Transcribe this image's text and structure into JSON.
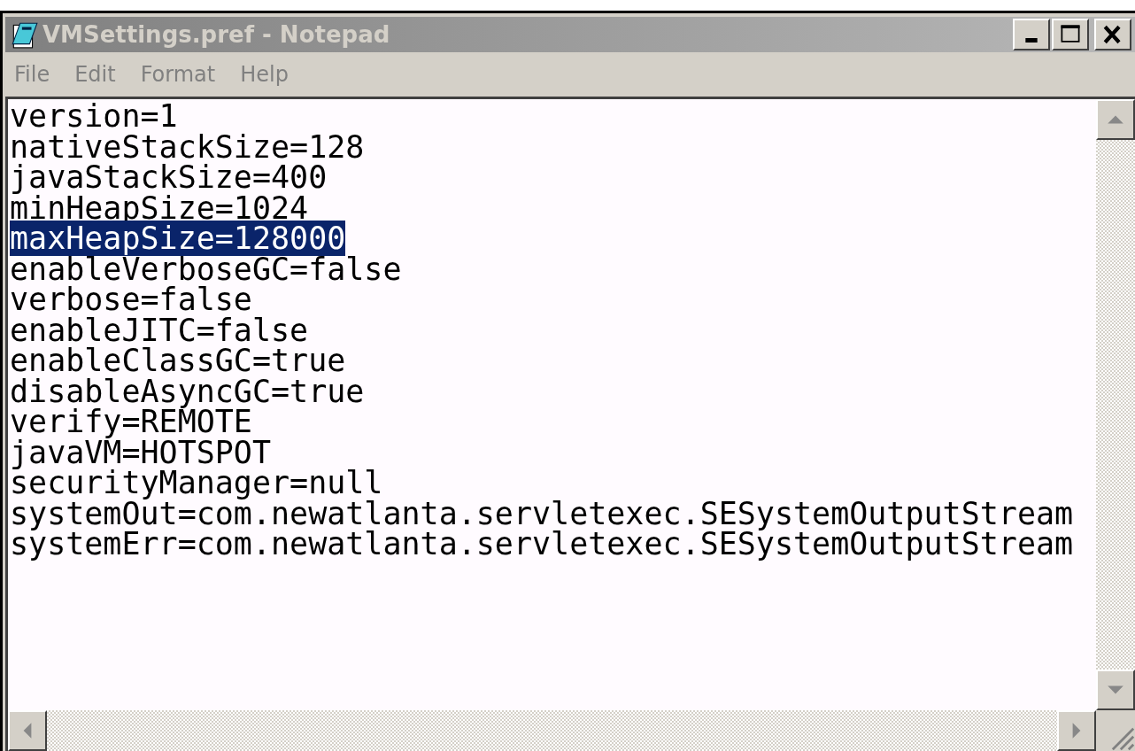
{
  "window": {
    "title": "VMSettings.pref - Notepad",
    "active": false
  },
  "menu": [
    {
      "label": "File"
    },
    {
      "label": "Edit"
    },
    {
      "label": "Format"
    },
    {
      "label": "Help"
    }
  ],
  "lines": [
    {
      "text": "version=1",
      "selected": false
    },
    {
      "text": "nativeStackSize=128",
      "selected": false
    },
    {
      "text": "javaStackSize=400",
      "selected": false
    },
    {
      "text": "minHeapSize=1024",
      "selected": false
    },
    {
      "text": "maxHeapSize=128000",
      "selected": true
    },
    {
      "text": "enableVerboseGC=false",
      "selected": false
    },
    {
      "text": "verbose=false",
      "selected": false
    },
    {
      "text": "enableJITC=false",
      "selected": false
    },
    {
      "text": "enableClassGC=true",
      "selected": false
    },
    {
      "text": "disableAsyncGC=true",
      "selected": false
    },
    {
      "text": "verify=REMOTE",
      "selected": false
    },
    {
      "text": "javaVM=HOTSPOT",
      "selected": false
    },
    {
      "text": "securityManager=null",
      "selected": false
    },
    {
      "text": "systemOut=com.newatlanta.servletexec.SESystemOutputStream",
      "selected": false
    },
    {
      "text": "systemErr=com.newatlanta.servletexec.SESystemOutputStream",
      "selected": false
    }
  ]
}
